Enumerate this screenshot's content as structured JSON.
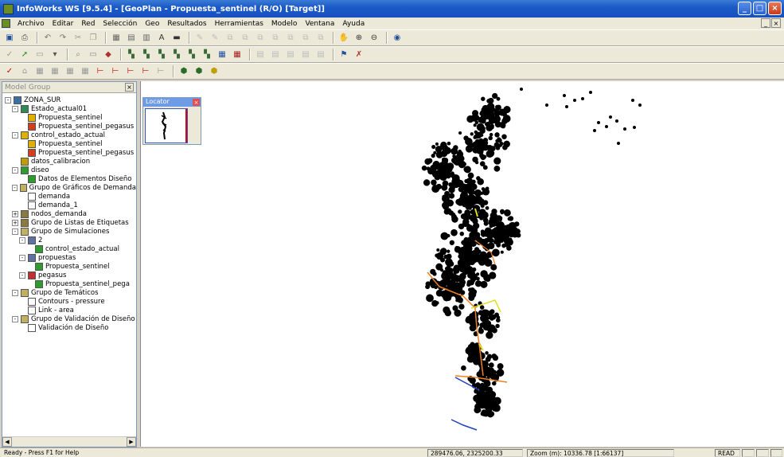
{
  "window": {
    "title": "InfoWorks WS [9.5.4] - [GeoPlan - Propuesta_sentinel (R/O) [Target]]",
    "buttons": [
      "_",
      "□",
      "×"
    ]
  },
  "menu": {
    "items": [
      "Archivo",
      "Editar",
      "Red",
      "Selección",
      "Geo",
      "Resultados",
      "Herramientas",
      "Modelo",
      "Ventana",
      "Ayuda"
    ],
    "mdi_buttons": [
      "_",
      "×"
    ]
  },
  "toolbars": {
    "row1": [
      "save-icon",
      "print-icon",
      "undo-icon",
      "redo-icon",
      "cut-icon",
      "copy-icon",
      "grid-icon",
      "hand-icon",
      "zoom-in-icon",
      "zoom-out-icon",
      "globe-icon"
    ],
    "row2": [
      "check-icon",
      "arrow-icon",
      "layer-icon",
      "palette-icon",
      "chart-icon",
      "table-icon"
    ],
    "row3": [
      "validate-icon",
      "link-icon",
      "node-icon",
      "pipe-icon",
      "valve-icon",
      "pump-icon"
    ]
  },
  "panel": {
    "title": "Model Group",
    "close": "×",
    "tree": [
      {
        "label": "ZONA_SUR",
        "level": 0,
        "exp": "-",
        "color": "#3a6ea5"
      },
      {
        "label": "Estado_actual01",
        "level": 1,
        "exp": "-",
        "color": "#2e8b57"
      },
      {
        "label": "Propuesta_sentinel",
        "level": 2,
        "exp": "",
        "color": "#e0b000"
      },
      {
        "label": "Propuesta_sentinel_pegasus",
        "level": 2,
        "exp": "",
        "color": "#d04020"
      },
      {
        "label": "control_estado_actual",
        "level": 1,
        "exp": "-",
        "color": "#e0b000"
      },
      {
        "label": "Propuesta_sentinel",
        "level": 2,
        "exp": "",
        "color": "#e0b000"
      },
      {
        "label": "Propuesta_sentinel_pegasus",
        "level": 2,
        "exp": "",
        "color": "#d04020"
      },
      {
        "label": "datos_calibracion",
        "level": 1,
        "exp": "",
        "color": "#c0a000"
      },
      {
        "label": "diseo",
        "level": 1,
        "exp": "-",
        "color": "#2e9b2e"
      },
      {
        "label": "Datos de Elementos Diseño",
        "level": 2,
        "exp": "",
        "color": "#2e9b2e"
      },
      {
        "label": "Grupo de Gráficos de Demanda",
        "level": 1,
        "exp": "-",
        "color": "#c0b060"
      },
      {
        "label": "demanda",
        "level": 2,
        "exp": "",
        "color": "#ffffff"
      },
      {
        "label": "demanda_1",
        "level": 2,
        "exp": "",
        "color": "#ffffff"
      },
      {
        "label": "nodos_demanda",
        "level": 1,
        "exp": "+",
        "color": "#8a7a40"
      },
      {
        "label": "Grupo de Listas de Etiquetas",
        "level": 1,
        "exp": "+",
        "color": "#8a7a40"
      },
      {
        "label": "Grupo de Simulaciones",
        "level": 1,
        "exp": "-",
        "color": "#c0b060"
      },
      {
        "label": "2",
        "level": 2,
        "exp": "-",
        "color": "#6070a0"
      },
      {
        "label": "control_estado_actual",
        "level": 3,
        "exp": "",
        "color": "#2e9b2e"
      },
      {
        "label": "propuestas",
        "level": 2,
        "exp": "-",
        "color": "#6070a0"
      },
      {
        "label": "Propuesta_sentinel",
        "level": 3,
        "exp": "",
        "color": "#2e9b2e"
      },
      {
        "label": "pegasus",
        "level": 2,
        "exp": "-",
        "color": "#c03030"
      },
      {
        "label": "Propuesta_sentinel_pega",
        "level": 3,
        "exp": "",
        "color": "#2e9b2e"
      },
      {
        "label": "Grupo de Temáticos",
        "level": 1,
        "exp": "-",
        "color": "#c0b060"
      },
      {
        "label": "Contours - pressure",
        "level": 2,
        "exp": "",
        "color": "#ffffff"
      },
      {
        "label": "Link - area",
        "level": 2,
        "exp": "",
        "color": "#ffffff"
      },
      {
        "label": "Grupo de Validación de Diseño",
        "level": 1,
        "exp": "-",
        "color": "#c0b060"
      },
      {
        "label": "Validación de Diseño",
        "level": 2,
        "exp": "",
        "color": "#ffffff"
      }
    ]
  },
  "locator": {
    "title": "Locator",
    "close": "×"
  },
  "status": {
    "help": "Ready - Press F1 for Help",
    "coords": "289476.06, 2325200.33",
    "zoom": "Zoom (m): 10336.78 [1:66137]",
    "mode": "READ"
  }
}
